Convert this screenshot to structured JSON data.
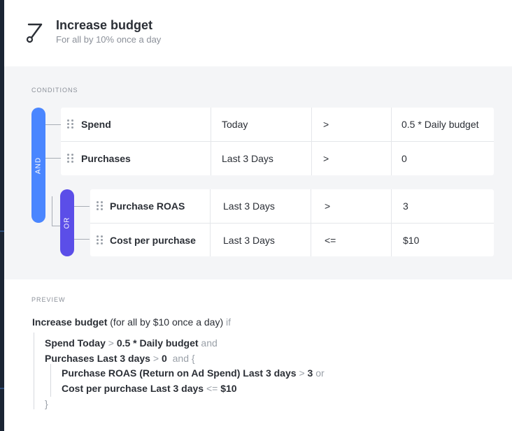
{
  "header": {
    "icon": "diagonal-line-icon",
    "title": "Increase budget",
    "subtitle": "For all by 10% once a day"
  },
  "conditions": {
    "section_label": "CONDITIONS",
    "and_label": "AND",
    "or_label": "OR",
    "and_rows": [
      {
        "metric": "Spend",
        "period": "Today",
        "operator": ">",
        "value": "0.5 * Daily budget"
      },
      {
        "metric": "Purchases",
        "period": "Last 3 Days",
        "operator": ">",
        "value": "0"
      }
    ],
    "or_rows": [
      {
        "metric": "Purchase ROAS",
        "period": "Last 3 Days",
        "operator": ">",
        "value": "3"
      },
      {
        "metric": "Cost per purchase",
        "period": "Last 3 Days",
        "operator": "<=",
        "value": "$10"
      }
    ]
  },
  "preview": {
    "section_label": "PREVIEW",
    "intro_bold": "Increase budget",
    "intro_rest": "(for all by $10 once a day)",
    "intro_if": "if",
    "line1": {
      "bold": "Spend Today",
      "op": ">",
      "value": "0.5 * Daily budget",
      "join": "and"
    },
    "line2": {
      "bold": "Purchases Last 3 days",
      "op": ">",
      "value": "0",
      "join": "and {"
    },
    "line3": {
      "bold": "Purchase ROAS (Return on Ad Spend) Last 3 days",
      "op": ">",
      "value": "3",
      "join": "or"
    },
    "line4": {
      "bold": "Cost per purchase Last 3 days",
      "op": "<=",
      "value": "$10"
    },
    "close": "}"
  }
}
